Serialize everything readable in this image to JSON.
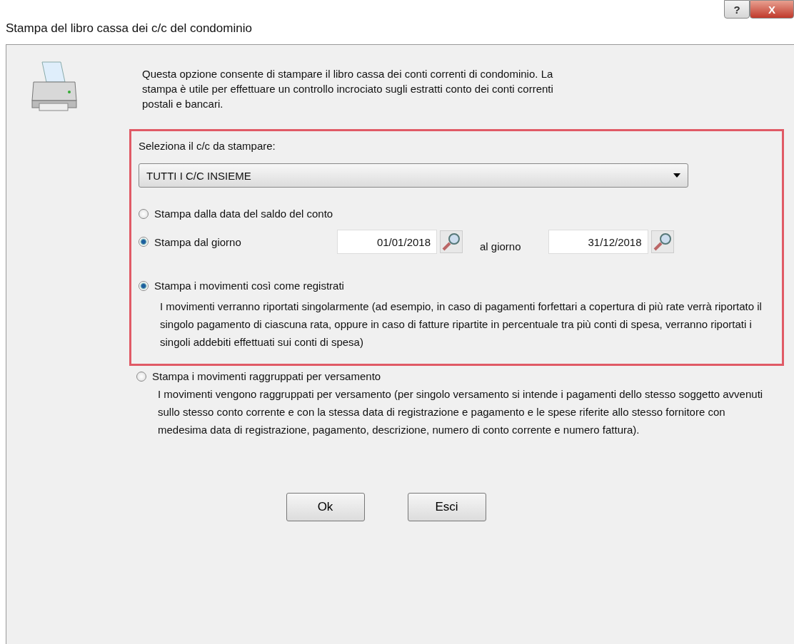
{
  "window": {
    "title": "Stampa del libro cassa dei c/c del condominio",
    "help_label": "?",
    "close_label": "X"
  },
  "intro": "Questa opzione consente di stampare il libro cassa dei conti correnti di condominio. La stampa è utile per effettuare un controllo incrociato sugli estratti conto dei conti correnti postali e bancari.",
  "account_select": {
    "label": "Seleziona il c/c da stampare:",
    "value": "TUTTI I C/C INSIEME"
  },
  "date_options": [
    {
      "kind": "plain",
      "label": "Stampa dalla data del saldo del conto",
      "selected": false
    },
    {
      "kind": "range",
      "label": "Stampa dal giorno",
      "selected": true,
      "from": "01/01/2018",
      "to_label": "al giorno",
      "to": "31/12/2018"
    }
  ],
  "print_modes": [
    {
      "label": "Stampa i movimenti così come registrati",
      "selected": true,
      "description": "I movimenti verranno riportati singolarmente (ad esempio, in caso di pagamenti forfettari a copertura di più rate verrà riportato il singolo pagamento di ciascuna rata, oppure in caso di fatture ripartite in percentuale tra più conti di spesa, verranno riportati i singoli addebiti effettuati sui conti di spesa)"
    },
    {
      "label": "Stampa i movimenti raggruppati per versamento",
      "selected": false,
      "description": "I movimenti vengono raggruppati per versamento (per singolo versamento si intende i pagamenti dello stesso soggetto avvenuti sullo stesso conto corrente e con la stessa data di registrazione e pagamento e le spese riferite allo stesso fornitore con medesima data di registrazione, pagamento, descrizione, numero di conto corrente e numero fattura)."
    }
  ],
  "buttons": [
    "Ok",
    "Esci"
  ]
}
